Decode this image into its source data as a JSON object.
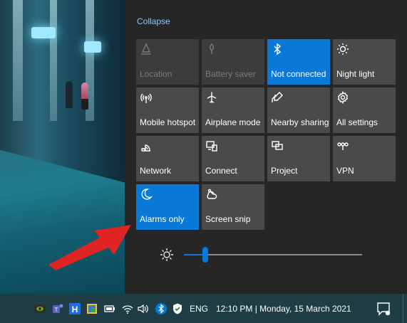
{
  "action_center": {
    "collapse_label": "Collapse",
    "accent_color": "#0a78d6",
    "tiles": [
      {
        "label": "Location",
        "icon": "location-icon",
        "state": "disabled"
      },
      {
        "label": "Battery saver",
        "icon": "battery-saver-icon",
        "state": "disabled"
      },
      {
        "label": "Not connected",
        "icon": "bluetooth-icon",
        "state": "active"
      },
      {
        "label": "Night light",
        "icon": "night-light-icon",
        "state": "off"
      },
      {
        "label": "Mobile hotspot",
        "icon": "mobile-hotspot-icon",
        "state": "off"
      },
      {
        "label": "Airplane mode",
        "icon": "airplane-icon",
        "state": "off"
      },
      {
        "label": "Nearby sharing",
        "icon": "nearby-sharing-icon",
        "state": "off"
      },
      {
        "label": "All settings",
        "icon": "gear-icon",
        "state": "off"
      },
      {
        "label": "Network",
        "icon": "network-icon",
        "state": "off"
      },
      {
        "label": "Connect",
        "icon": "connect-icon",
        "state": "off"
      },
      {
        "label": "Project",
        "icon": "project-icon",
        "state": "off"
      },
      {
        "label": "VPN",
        "icon": "vpn-icon",
        "state": "off"
      },
      {
        "label": "Alarms only",
        "icon": "focus-assist-moon-icon",
        "state": "active"
      },
      {
        "label": "Screen snip",
        "icon": "screen-snip-icon",
        "state": "off"
      }
    ],
    "brightness": {
      "icon": "brightness-icon",
      "level": 0.12
    }
  },
  "annotation": {
    "icon": "red-arrow-icon",
    "color": "#e02424"
  },
  "taskbar": {
    "tray_icons": [
      "nvidia-icon",
      "teams-icon",
      "h-app-icon",
      "image-app-icon",
      "battery-icon",
      "wifi-icon",
      "volume-icon",
      "bluetooth-tray-icon",
      "security-shield-icon"
    ],
    "language": "ENG",
    "clock": "12:10 PM | Monday, 15 March 2021",
    "notification_icon": "notification-center-icon"
  }
}
